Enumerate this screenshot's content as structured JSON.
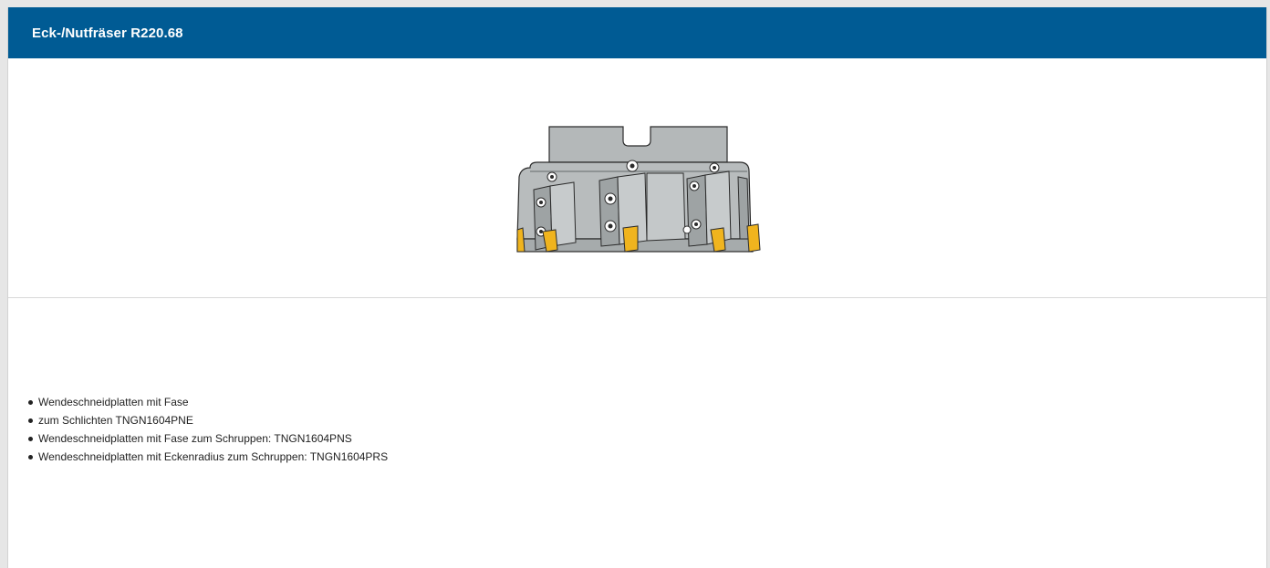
{
  "header": {
    "title": "Eck-/Nutfräser R220.68"
  },
  "product_image": {
    "icon": "milling-cutter-image",
    "colors": {
      "body": "#b4b8b9",
      "body_dark": "#8e9394",
      "outline": "#2b2b2b",
      "insert": "#f0b41e"
    }
  },
  "features": {
    "items": [
      {
        "text": "Wendeschneidplatten mit Fase"
      },
      {
        "text": "zum Schlichten TNGN1604PNE"
      },
      {
        "text": "Wendeschneidplatten mit Fase zum Schruppen: TNGN1604PNS"
      },
      {
        "text": "Wendeschneidplatten mit Eckenradius zum Schruppen: TNGN1604PRS"
      }
    ]
  },
  "colors": {
    "header_bg": "#005b94",
    "header_text": "#ffffff",
    "page_bg": "#e6e6e6",
    "card_bg": "#ffffff",
    "divider": "#d9d9d9"
  }
}
